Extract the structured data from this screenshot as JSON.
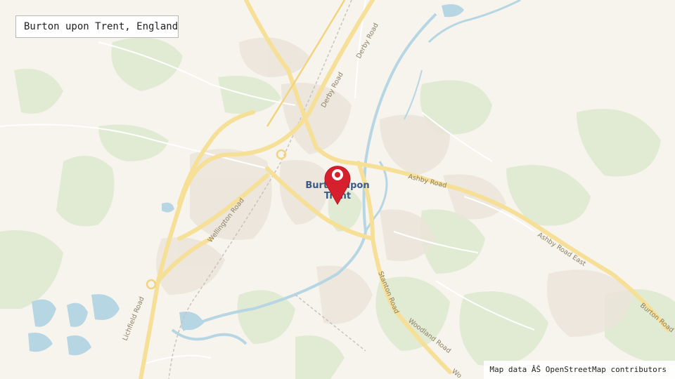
{
  "map": {
    "location_title": "Burton upon Trent, England",
    "attribution": "Map data ÂŠ OpenStreetMap contributors",
    "place_label": {
      "line1": "Burton upon",
      "line2": "Trent"
    },
    "road_labels": {
      "derby_road_north": "Derby Road",
      "derby_road_south": "Derby Road",
      "wellington_road": "Wellington Road",
      "ashby_road": "Ashby Road",
      "ashby_road_east": "Ashby Road East",
      "burton_road": "Burton Road",
      "stanton_road": "Stanton Road",
      "woodland_road": "Woodland Road",
      "lichfield_road": "Lichfield Road",
      "wo_label": "Wo"
    },
    "marker_icon": "map-pin-icon",
    "colors": {
      "land": "#f7f4ee",
      "park": "#e1ebd3",
      "water": "#b7d6e4",
      "major_road": "#f6df96",
      "minor_road": "#ffffff",
      "urban": "#ebe4d9",
      "marker": "#d7202d"
    }
  }
}
